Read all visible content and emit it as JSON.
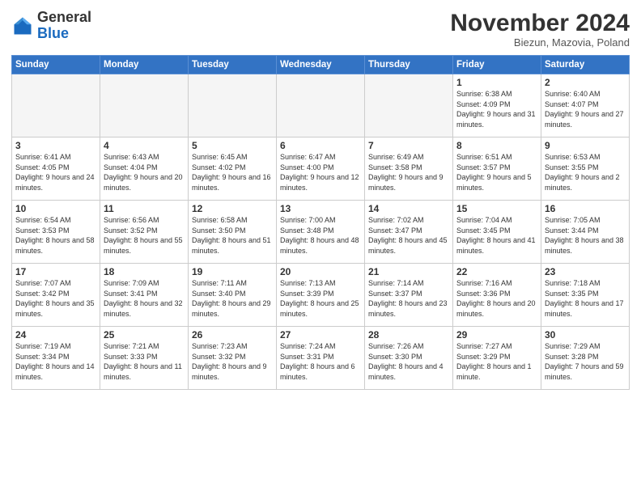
{
  "header": {
    "logo_general": "General",
    "logo_blue": "Blue",
    "month_title": "November 2024",
    "location": "Biezun, Mazovia, Poland"
  },
  "days_of_week": [
    "Sunday",
    "Monday",
    "Tuesday",
    "Wednesday",
    "Thursday",
    "Friday",
    "Saturday"
  ],
  "weeks": [
    [
      {
        "day": "",
        "info": "",
        "empty": true
      },
      {
        "day": "",
        "info": "",
        "empty": true
      },
      {
        "day": "",
        "info": "",
        "empty": true
      },
      {
        "day": "",
        "info": "",
        "empty": true
      },
      {
        "day": "",
        "info": "",
        "empty": true
      },
      {
        "day": "1",
        "info": "Sunrise: 6:38 AM\nSunset: 4:09 PM\nDaylight: 9 hours\nand 31 minutes."
      },
      {
        "day": "2",
        "info": "Sunrise: 6:40 AM\nSunset: 4:07 PM\nDaylight: 9 hours\nand 27 minutes."
      }
    ],
    [
      {
        "day": "3",
        "info": "Sunrise: 6:41 AM\nSunset: 4:05 PM\nDaylight: 9 hours\nand 24 minutes."
      },
      {
        "day": "4",
        "info": "Sunrise: 6:43 AM\nSunset: 4:04 PM\nDaylight: 9 hours\nand 20 minutes."
      },
      {
        "day": "5",
        "info": "Sunrise: 6:45 AM\nSunset: 4:02 PM\nDaylight: 9 hours\nand 16 minutes."
      },
      {
        "day": "6",
        "info": "Sunrise: 6:47 AM\nSunset: 4:00 PM\nDaylight: 9 hours\nand 12 minutes."
      },
      {
        "day": "7",
        "info": "Sunrise: 6:49 AM\nSunset: 3:58 PM\nDaylight: 9 hours\nand 9 minutes."
      },
      {
        "day": "8",
        "info": "Sunrise: 6:51 AM\nSunset: 3:57 PM\nDaylight: 9 hours\nand 5 minutes."
      },
      {
        "day": "9",
        "info": "Sunrise: 6:53 AM\nSunset: 3:55 PM\nDaylight: 9 hours\nand 2 minutes."
      }
    ],
    [
      {
        "day": "10",
        "info": "Sunrise: 6:54 AM\nSunset: 3:53 PM\nDaylight: 8 hours\nand 58 minutes."
      },
      {
        "day": "11",
        "info": "Sunrise: 6:56 AM\nSunset: 3:52 PM\nDaylight: 8 hours\nand 55 minutes."
      },
      {
        "day": "12",
        "info": "Sunrise: 6:58 AM\nSunset: 3:50 PM\nDaylight: 8 hours\nand 51 minutes."
      },
      {
        "day": "13",
        "info": "Sunrise: 7:00 AM\nSunset: 3:48 PM\nDaylight: 8 hours\nand 48 minutes."
      },
      {
        "day": "14",
        "info": "Sunrise: 7:02 AM\nSunset: 3:47 PM\nDaylight: 8 hours\nand 45 minutes."
      },
      {
        "day": "15",
        "info": "Sunrise: 7:04 AM\nSunset: 3:45 PM\nDaylight: 8 hours\nand 41 minutes."
      },
      {
        "day": "16",
        "info": "Sunrise: 7:05 AM\nSunset: 3:44 PM\nDaylight: 8 hours\nand 38 minutes."
      }
    ],
    [
      {
        "day": "17",
        "info": "Sunrise: 7:07 AM\nSunset: 3:42 PM\nDaylight: 8 hours\nand 35 minutes."
      },
      {
        "day": "18",
        "info": "Sunrise: 7:09 AM\nSunset: 3:41 PM\nDaylight: 8 hours\nand 32 minutes."
      },
      {
        "day": "19",
        "info": "Sunrise: 7:11 AM\nSunset: 3:40 PM\nDaylight: 8 hours\nand 29 minutes."
      },
      {
        "day": "20",
        "info": "Sunrise: 7:13 AM\nSunset: 3:39 PM\nDaylight: 8 hours\nand 25 minutes."
      },
      {
        "day": "21",
        "info": "Sunrise: 7:14 AM\nSunset: 3:37 PM\nDaylight: 8 hours\nand 23 minutes."
      },
      {
        "day": "22",
        "info": "Sunrise: 7:16 AM\nSunset: 3:36 PM\nDaylight: 8 hours\nand 20 minutes."
      },
      {
        "day": "23",
        "info": "Sunrise: 7:18 AM\nSunset: 3:35 PM\nDaylight: 8 hours\nand 17 minutes."
      }
    ],
    [
      {
        "day": "24",
        "info": "Sunrise: 7:19 AM\nSunset: 3:34 PM\nDaylight: 8 hours\nand 14 minutes."
      },
      {
        "day": "25",
        "info": "Sunrise: 7:21 AM\nSunset: 3:33 PM\nDaylight: 8 hours\nand 11 minutes."
      },
      {
        "day": "26",
        "info": "Sunrise: 7:23 AM\nSunset: 3:32 PM\nDaylight: 8 hours\nand 9 minutes."
      },
      {
        "day": "27",
        "info": "Sunrise: 7:24 AM\nSunset: 3:31 PM\nDaylight: 8 hours\nand 6 minutes."
      },
      {
        "day": "28",
        "info": "Sunrise: 7:26 AM\nSunset: 3:30 PM\nDaylight: 8 hours\nand 4 minutes."
      },
      {
        "day": "29",
        "info": "Sunrise: 7:27 AM\nSunset: 3:29 PM\nDaylight: 8 hours\nand 1 minute."
      },
      {
        "day": "30",
        "info": "Sunrise: 7:29 AM\nSunset: 3:28 PM\nDaylight: 7 hours\nand 59 minutes."
      }
    ]
  ]
}
